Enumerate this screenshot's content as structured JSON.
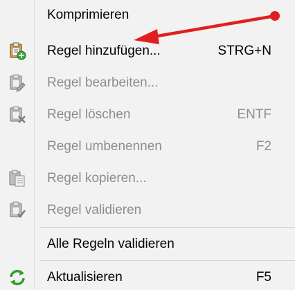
{
  "menu": {
    "items": [
      {
        "label": "Komprimieren",
        "shortcut": "",
        "icon": "none",
        "enabled": true
      },
      {
        "label": "Regel hinzufügen...",
        "shortcut": "STRG+N",
        "icon": "clipboard-add-icon",
        "enabled": true
      },
      {
        "label": "Regel bearbeiten...",
        "shortcut": "",
        "icon": "clipboard-edit-icon",
        "enabled": false
      },
      {
        "label": "Regel löschen",
        "shortcut": "ENTF",
        "icon": "clipboard-delete-icon",
        "enabled": false
      },
      {
        "label": "Regel umbenennen",
        "shortcut": "F2",
        "icon": "none",
        "enabled": false
      },
      {
        "label": "Regel kopieren...",
        "shortcut": "",
        "icon": "clipboard-copy-icon",
        "enabled": false
      },
      {
        "label": "Regel validieren",
        "shortcut": "",
        "icon": "clipboard-check-icon",
        "enabled": false
      },
      {
        "label": "Alle Regeln validieren",
        "shortcut": "",
        "icon": "none",
        "enabled": true
      },
      {
        "label": "Aktualisieren",
        "shortcut": "F5",
        "icon": "refresh-icon",
        "enabled": true
      }
    ]
  },
  "colors": {
    "menu_background": "#f2f2f2",
    "disabled_text": "#8d8d8d",
    "annotation_arrow": "#e02020",
    "refresh_icon": "#2ea02e"
  }
}
